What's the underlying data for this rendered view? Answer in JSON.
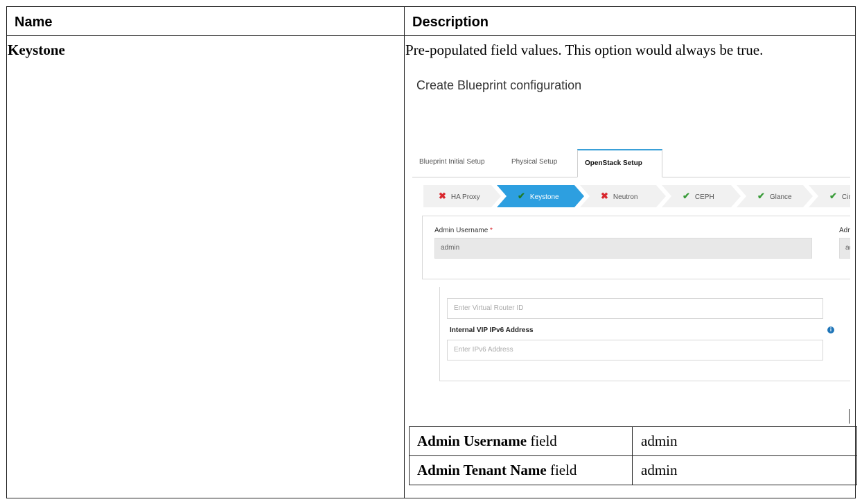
{
  "header": {
    "name_label": "Name",
    "description_label": "Description"
  },
  "row": {
    "name": "Keystone",
    "description": "Pre-populated field values. This option would always be true."
  },
  "screenshot": {
    "title": "Create Blueprint configuration",
    "tabs": [
      {
        "label": "Blueprint Initial Setup",
        "active": false
      },
      {
        "label": "Physical Setup",
        "active": false
      },
      {
        "label": "OpenStack Setup",
        "active": true
      }
    ],
    "steps": [
      {
        "label": "HA Proxy",
        "status": "error"
      },
      {
        "label": "Keystone",
        "status": "ok",
        "active": true
      },
      {
        "label": "Neutron",
        "status": "error"
      },
      {
        "label": "CEPH",
        "status": "ok"
      },
      {
        "label": "Glance",
        "status": "ok"
      },
      {
        "label": "Cinder",
        "status": "ok"
      }
    ],
    "admin_username_label": "Admin Username",
    "admin_username_value": "admin",
    "right_label_fragment": "Adm",
    "right_value_fragment": "ad",
    "virtual_router_placeholder": "Enter Virtual Router ID",
    "ipv6_label": "Internal VIP IPv6 Address",
    "ipv6_placeholder": "Enter IPv6 Address"
  },
  "fields_table": [
    {
      "label_bold": "Admin Username",
      "label_suffix": " field",
      "value": "admin"
    },
    {
      "label_bold": "Admin Tenant Name",
      "label_suffix": " field",
      "value": "admin"
    }
  ],
  "colors": {
    "accent": "#2d9fe0",
    "error": "#d9272e",
    "ok": "#3a9c3a"
  },
  "icons": {
    "error": "close-x-icon",
    "ok": "checkmark-icon",
    "info": "info-icon"
  }
}
